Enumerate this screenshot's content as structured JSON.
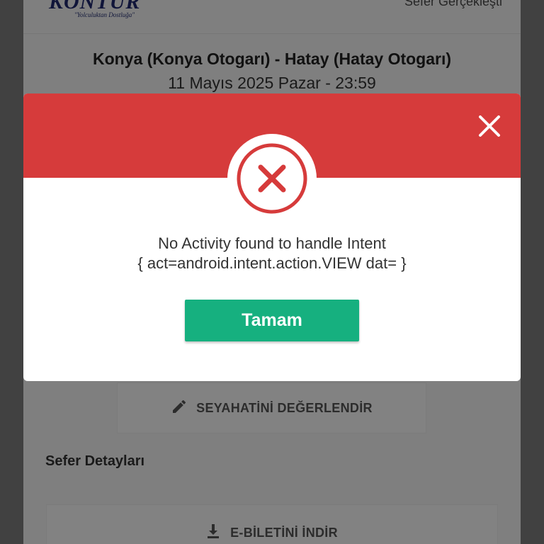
{
  "app": {
    "logo_text": "KONTUR",
    "logo_tagline": "\"Yolculuktan Dostluğa\"",
    "trip_status": "Sefer Gerçekleşti"
  },
  "trip": {
    "route": "Konya (Konya Otogarı) - Hatay (Hatay Otogarı)",
    "date": "11 Mayıs 2025 Pazar - 23:59"
  },
  "actions": {
    "rate_label": "SEYAHATİNİ DEĞERLENDİR",
    "rate_icon": "pencil-icon",
    "section_title": "Sefer Detayları",
    "download_label": "E-BİLETİNİ İNDİR",
    "download_icon": "download-icon"
  },
  "dialog": {
    "message_line1": "No Activity found to handle Intent",
    "message_line2": "{ act=android.intent.action.VIEW dat= }",
    "ok_label": "Tamam",
    "header_color": "#d63b3b",
    "button_color": "#16b07f",
    "status_icon": "error-x-icon",
    "close_icon": "close-icon"
  }
}
